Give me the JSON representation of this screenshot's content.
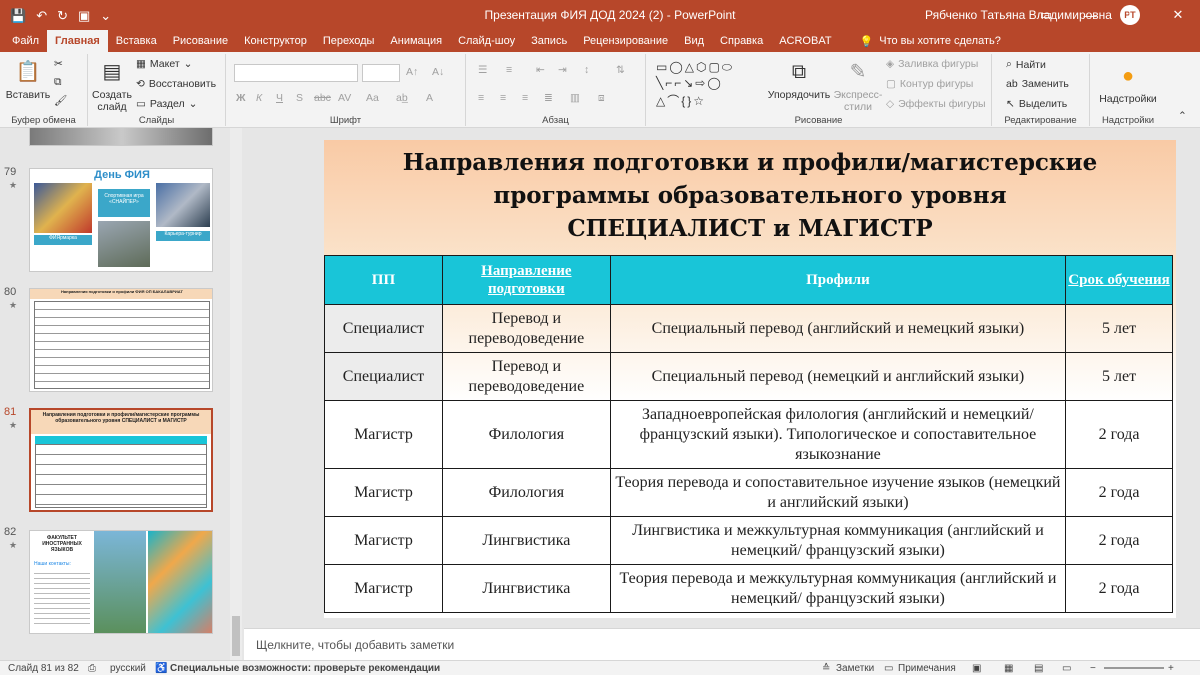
{
  "titlebar": {
    "doc_title": "Презентация ФИЯ ДОД 2024  (2)  -  PowerPoint",
    "user_name": "Рябченко Татьяна Владимировна",
    "user_initials": "РТ"
  },
  "tabs": [
    "Файл",
    "Главная",
    "Вставка",
    "Рисование",
    "Конструктор",
    "Переходы",
    "Анимация",
    "Слайд-шоу",
    "Запись",
    "Рецензирование",
    "Вид",
    "Справка",
    "ACROBAT"
  ],
  "tell_me": "Что вы хотите сделать?",
  "ribbon": {
    "clipboard": {
      "paste": "Вставить",
      "label": "Буфер обмена"
    },
    "slides": {
      "new_slide": "Создать слайд",
      "layout": "Макет",
      "reset": "Восстановить",
      "section": "Раздел",
      "label": "Слайды"
    },
    "font": {
      "label": "Шрифт",
      "bold": "Ж",
      "italic": "К",
      "underline": "Ч",
      "strike": "S",
      "abc": "abc",
      "spacing": "AV",
      "case": "Aa"
    },
    "paragraph": {
      "label": "Абзац"
    },
    "drawing": {
      "arrange": "Упорядочить",
      "quick_styles": "Экспресс-стили",
      "fill": "Заливка фигуры",
      "outline": "Контур фигуры",
      "effects": "Эффекты фигуры",
      "label": "Рисование"
    },
    "editing": {
      "find": "Найти",
      "replace": "Заменить",
      "select": "Выделить",
      "label": "Редактирование"
    },
    "settings": {
      "button": "Надстройки",
      "label": "Надстройки"
    }
  },
  "thumbnails": [
    {
      "num": "79",
      "star": "★",
      "title": "День ФИЯ",
      "cap1": "ФИЯрмарка",
      "cap2": "Спортивная игра «СНАЙПЕР»",
      "cap3": "Карьера-турнир"
    },
    {
      "num": "80",
      "star": "★",
      "title": "Направления подготовки и профили ФИЯ ОП БАКАЛАВРИАТ"
    },
    {
      "num": "81",
      "star": "★",
      "title": "Направления подготовки и профили/магистерские программы образовательного уровня СПЕЦИАЛИСТ и МАГИСТР"
    },
    {
      "num": "82",
      "star": "★",
      "title": "ФАКУЛЬТЕТ ИНОСТРАННЫХ ЯЗЫКОВ",
      "sub": "Наши контакты:"
    }
  ],
  "slide": {
    "title_line1": "Направления подготовки и профили/магистерские",
    "title_line2": "программы образовательного уровня",
    "title_line3": "СПЕЦИАЛИСТ и МАГИСТР",
    "headers": [
      "ПП",
      "Направление подготовки",
      "Профили",
      "Срок обучения"
    ],
    "rows": [
      {
        "level": "Специалист",
        "direction": "Перевод и переводоведение",
        "profile": "Специальный перевод (английский и немецкий языки)",
        "term": "5 лет"
      },
      {
        "level": "Специалист",
        "direction": "Перевод и переводоведение",
        "profile": "Специальный перевод (немецкий и английский языки)",
        "term": "5 лет"
      },
      {
        "level": "Магистр",
        "direction": "Филология",
        "profile": "Западноевропейская филология (английский и немецкий/французский  языки). Типологическое и сопоставительное языкознание",
        "term": "2 года"
      },
      {
        "level": "Магистр",
        "direction": "Филология",
        "profile": "Теория перевода и сопоставительное изучение языков (немецкий и английский языки)",
        "term": "2 года"
      },
      {
        "level": "Магистр",
        "direction": "Лингвистика",
        "profile": "Лингвистика и межкультурная коммуникация (английский и немецкий/ французский языки)",
        "term": "2 года"
      },
      {
        "level": "Магистр",
        "direction": "Лингвистика",
        "profile": "Теория перевода и межкультурная коммуникация (английский и немецкий/ французский языки)",
        "term": "2 года"
      }
    ]
  },
  "notes_placeholder": "Щелкните, чтобы добавить заметки",
  "statusbar": {
    "slide_counter": "Слайд 81 из 82",
    "language": "русский",
    "accessibility": "Специальные возможности: проверьте рекомендации",
    "notes": "Заметки",
    "comments": "Примечания"
  },
  "colors": {
    "accent": "#b7472a",
    "table_header": "#19c5d8"
  }
}
